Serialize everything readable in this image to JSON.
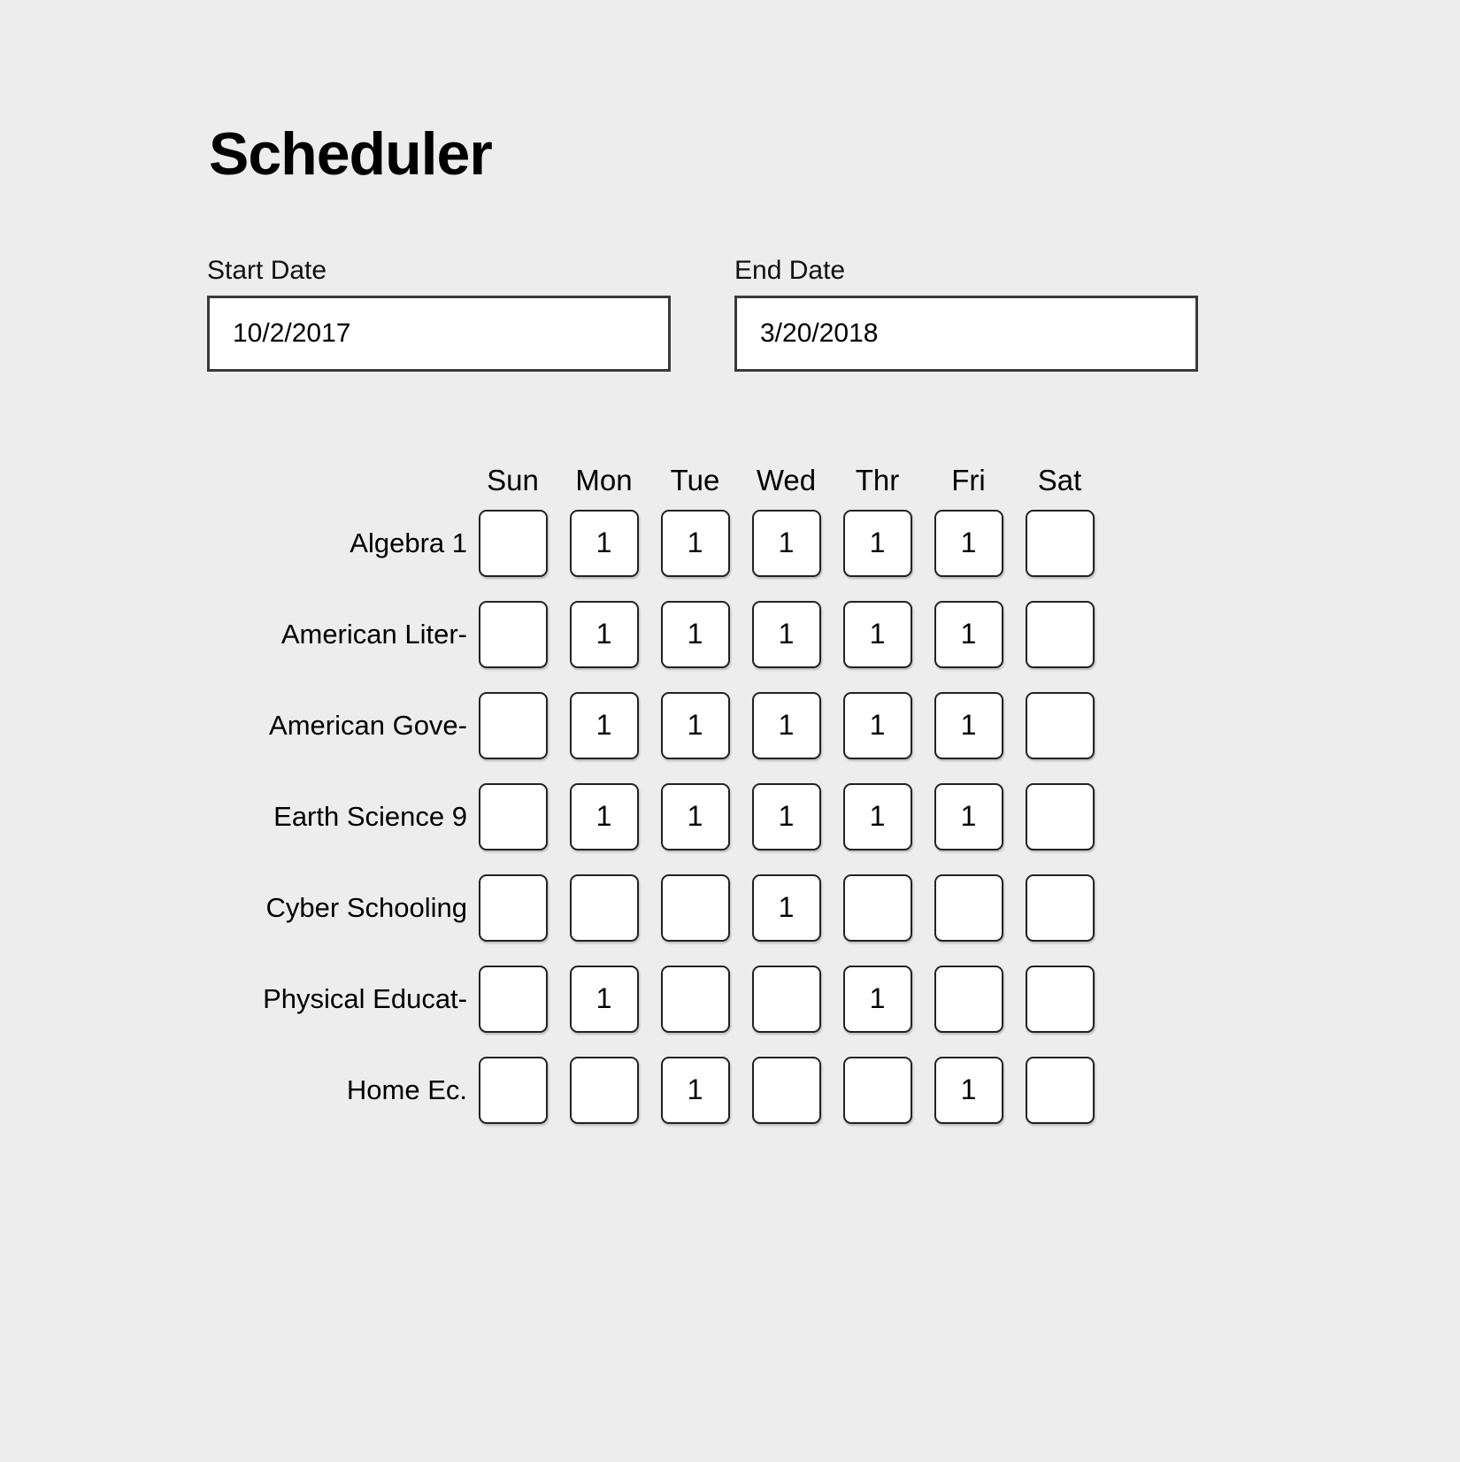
{
  "app": {
    "title": "Scheduler",
    "background_color": "#ededed",
    "text_color": "#000000"
  },
  "form": {
    "start_date": {
      "label": "Start Date",
      "value": "10/2/2017",
      "placeholder": "Start Date"
    },
    "end_date": {
      "label": "End Date",
      "value": "3/20/2018",
      "placeholder": "End Date"
    }
  },
  "schedule": {
    "day_headers": [
      "Sun",
      "Mon",
      "Tue",
      "Wed",
      "Thr",
      "Fri",
      "Sat"
    ],
    "checked_value": "1",
    "unchecked_value": "",
    "rows": [
      {
        "label": "Algebra 1",
        "cells": [
          "",
          "1",
          "1",
          "1",
          "1",
          "1",
          ""
        ]
      },
      {
        "label": "American Liter-",
        "cells": [
          "",
          "1",
          "1",
          "1",
          "1",
          "1",
          ""
        ]
      },
      {
        "label": "American Gove-",
        "cells": [
          "",
          "1",
          "1",
          "1",
          "1",
          "1",
          ""
        ]
      },
      {
        "label": "Earth Science 9",
        "cells": [
          "",
          "1",
          "1",
          "1",
          "1",
          "1",
          ""
        ]
      },
      {
        "label": "Cyber Schooling",
        "cells": [
          "",
          "",
          "",
          "1",
          "",
          "",
          ""
        ]
      },
      {
        "label": "Physical Educat-",
        "cells": [
          "",
          "1",
          "",
          "",
          "1",
          "",
          ""
        ]
      },
      {
        "label": "Home Ec.",
        "cells": [
          "",
          "",
          "1",
          "",
          "",
          "1",
          ""
        ]
      }
    ]
  }
}
